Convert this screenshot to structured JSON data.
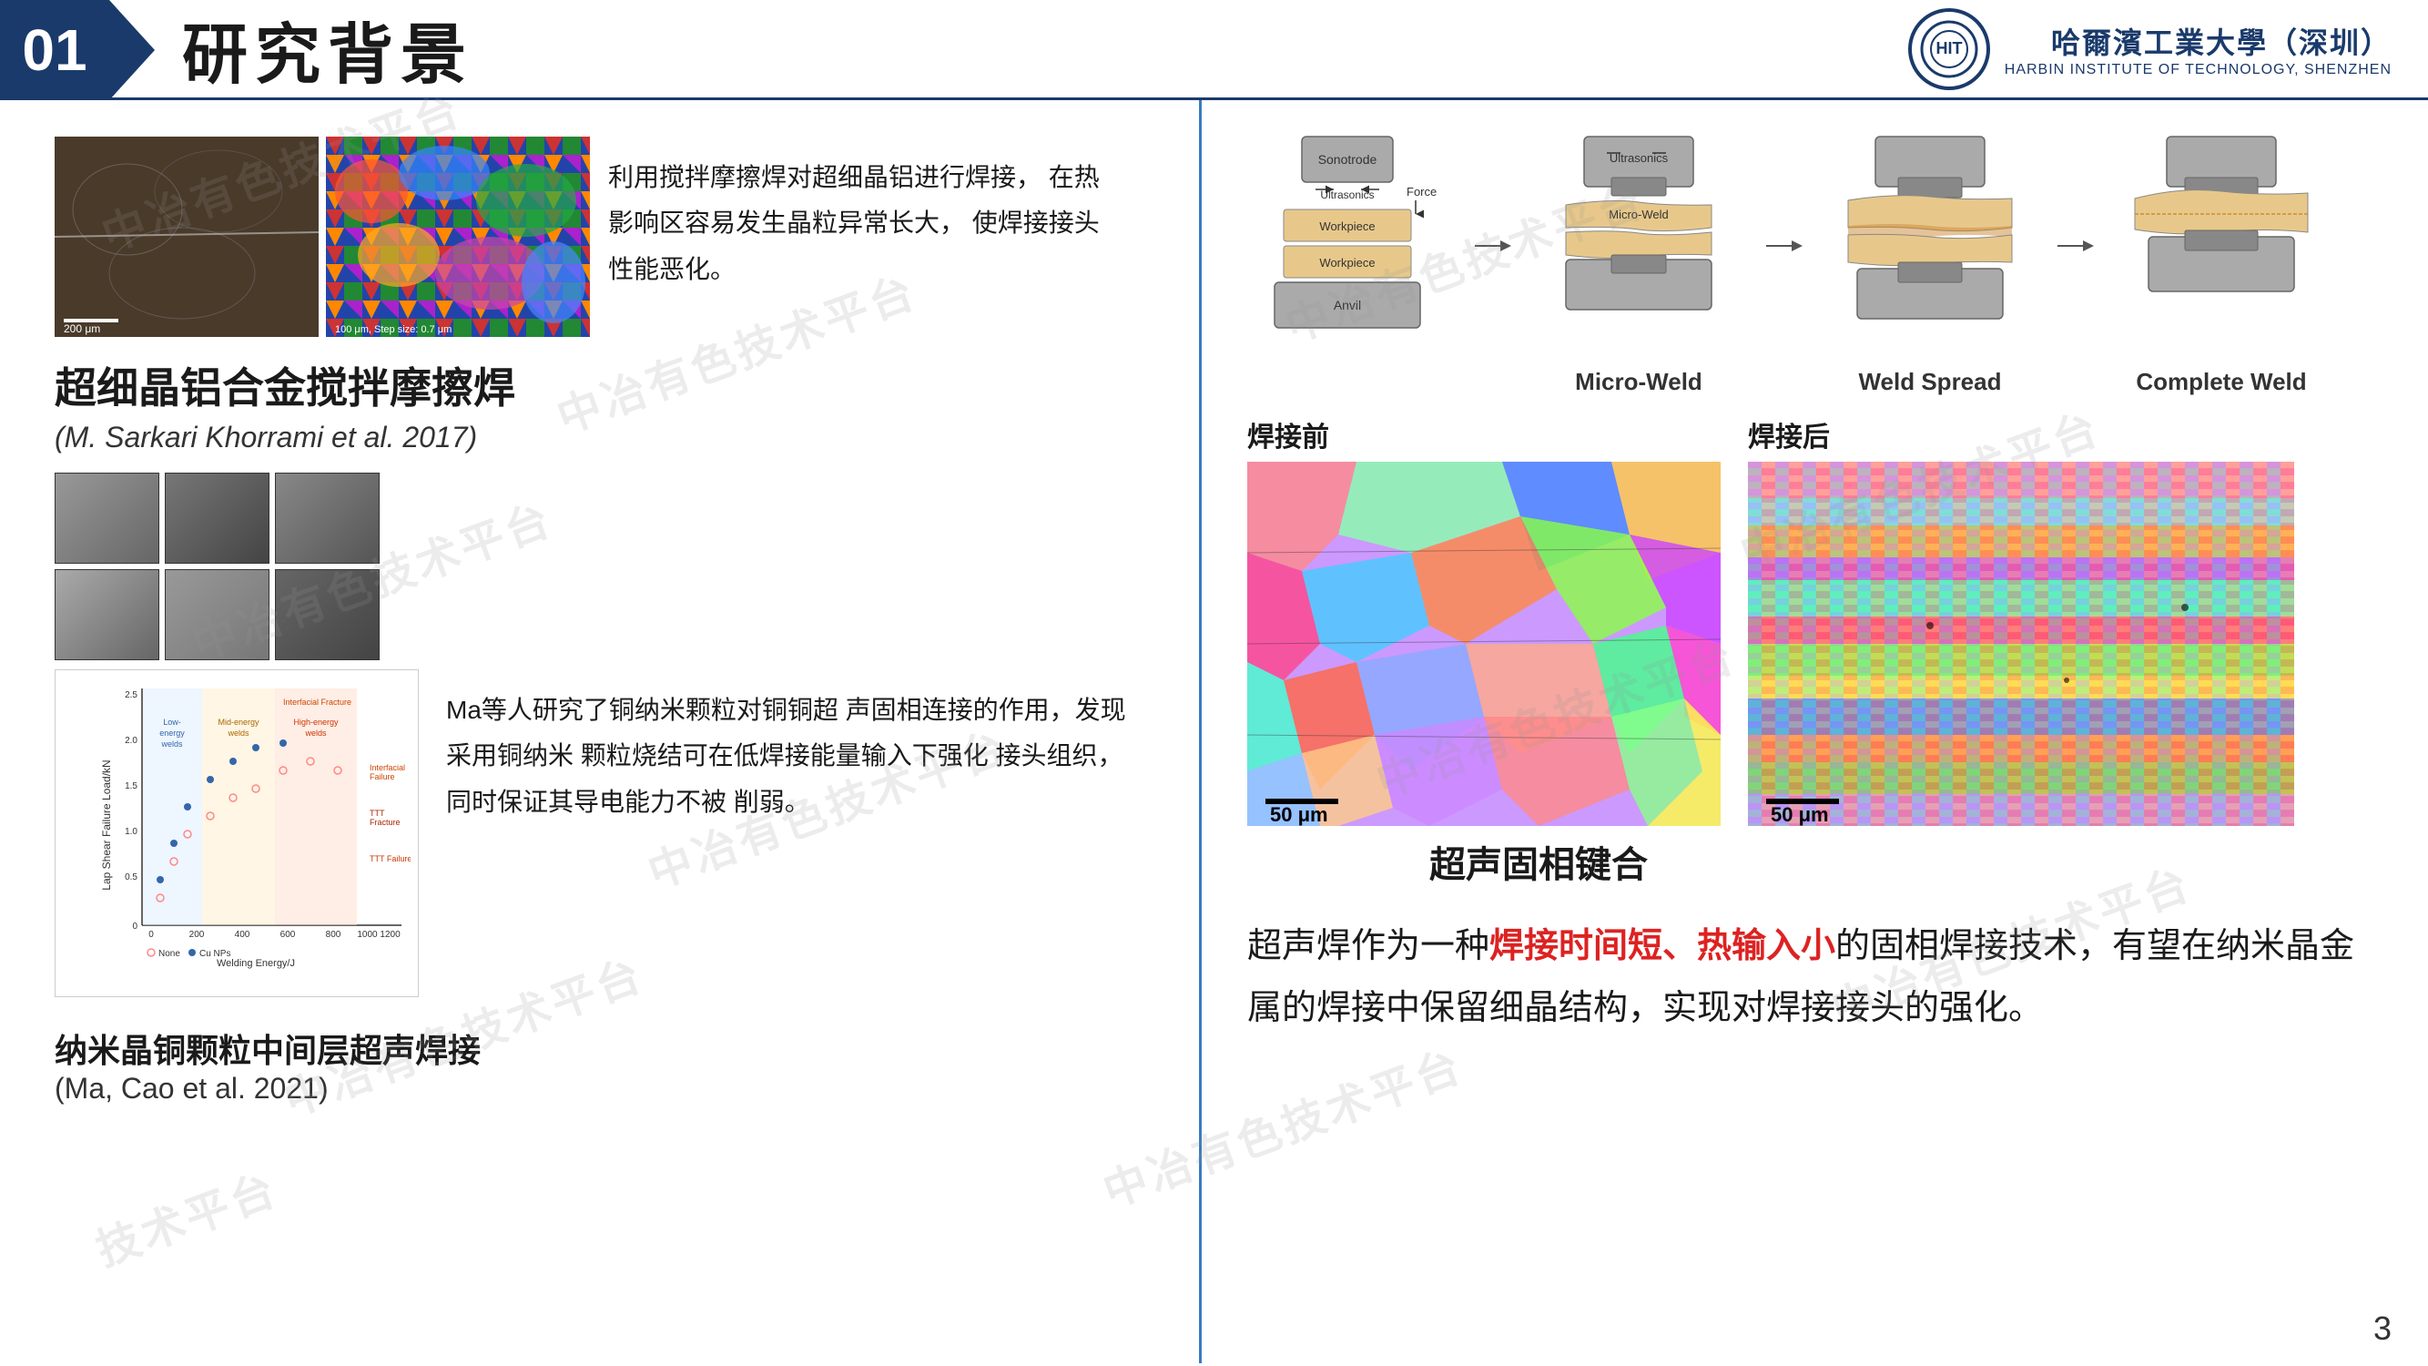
{
  "header": {
    "number": "01",
    "title": "研究背景",
    "logo_cn": "哈爾濱工業大學（深圳）",
    "logo_en": "HARBIN INSTITUTE OF TECHNOLOGY, SHENZHEN"
  },
  "watermarks": [
    "中冶有色技术平台",
    "中冶有色技术平台",
    "中冶有色技术平台",
    "中冶有色技术平台",
    "中冶有色技术平台",
    "中冶有色技术平台",
    "技术平台"
  ],
  "left": {
    "caption_top": "利用搅拌摩擦焊对超细晶铝进行焊接，\n在热影响区容易发生晶粒异常长大，\n使焊接接头性能恶化。",
    "section1_title": "超细晶铝合金搅拌摩擦焊",
    "section1_subtitle": "(M. Sarkari Khorrami et al. 2017)",
    "caption_mid": "Ma等人研究了铜纳米颗粒对铜铜超\n声固相连接的作用，发现采用铜纳米\n颗粒烧结可在低焊接能量输入下强化\n接头组织，同时保证其导电能力不被\n削弱。",
    "bottom_title": "纳米晶铜颗粒中间层超声焊接",
    "bottom_subtitle": "(Ma, Cao et al. 2021)"
  },
  "right": {
    "weld_stages": [
      {
        "label": "",
        "parts": [
          "Sonotrode",
          "Ultrasonics",
          "Force",
          "Workpiece",
          "Micro-Weld",
          "Workpiece",
          "Anvil"
        ]
      },
      {
        "label": "Weld Spread"
      },
      {
        "label": "Complete Weld"
      }
    ],
    "before_label": "焊接前",
    "after_label": "焊接后",
    "scale1": "50 μm",
    "scale2": "50 μm",
    "sub_title": "超声固相键合",
    "conclusion": "超声焊作为一种",
    "conclusion_highlight": "焊接时间短、热输入小",
    "conclusion_rest": "的固相焊接技术，有望在纳米晶金属的焊接中保留细晶结构，实现对焊接接头的强化。"
  },
  "page_number": "3"
}
